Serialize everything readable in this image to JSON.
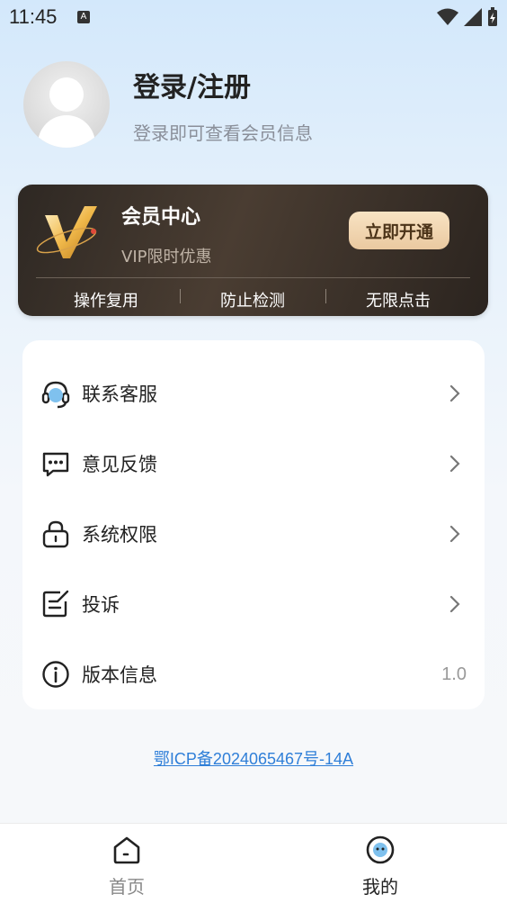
{
  "status_bar": {
    "time": "11:45",
    "notif_letter": "A"
  },
  "profile": {
    "title": "登录/注册",
    "subtitle": "登录即可查看会员信息"
  },
  "vip": {
    "title": "会员中心",
    "subtitle": "VIP限时优惠",
    "button": "立即开通",
    "features": [
      "操作复用",
      "防止检测",
      "无限点击"
    ],
    "accent": "#eac9a0"
  },
  "menu": [
    {
      "label": "联系客服",
      "icon": "headset-icon"
    },
    {
      "label": "意见反馈",
      "icon": "chat-bubble-icon"
    },
    {
      "label": "系统权限",
      "icon": "lock-icon"
    },
    {
      "label": "投诉",
      "icon": "edit-note-icon"
    },
    {
      "label": "版本信息",
      "icon": "info-icon",
      "value": "1.0"
    }
  ],
  "icp": "鄂ICP备2024065467号-14A",
  "nav": [
    {
      "label": "首页",
      "icon": "home-icon",
      "active": false
    },
    {
      "label": "我的",
      "icon": "profile-icon",
      "active": true
    }
  ],
  "colors": {
    "link": "#2f7fd8",
    "nav_inactive": "#888888",
    "nav_active": "#222222"
  }
}
